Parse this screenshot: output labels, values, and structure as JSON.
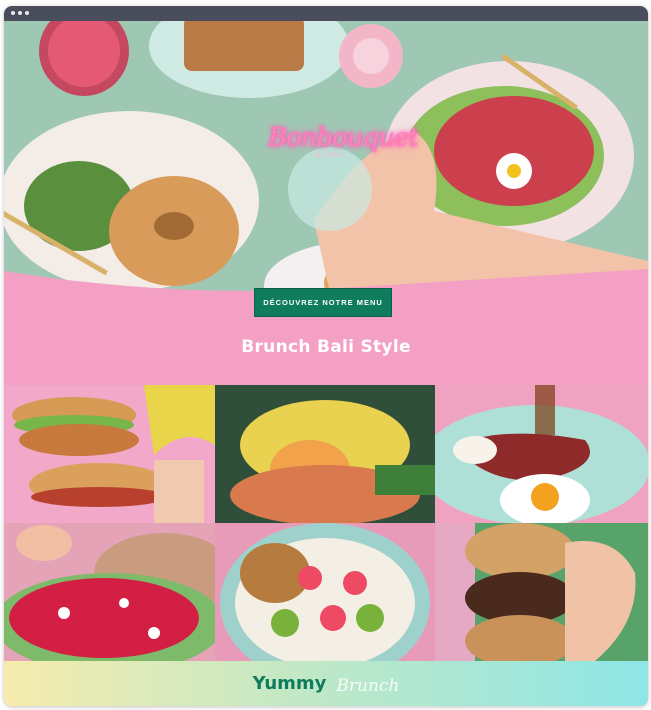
{
  "window": {
    "controls": [
      "dot",
      "dot",
      "dot"
    ]
  },
  "hero": {
    "logo_script": "Bonbouquet",
    "logo_sub": "& CALI",
    "cta_label": "DÉCOUVREZ NOTRE MENU",
    "headline": "Brunch Bali Style"
  },
  "gallery": {
    "tiles": [
      {
        "name": "bagel-sandwich-photo"
      },
      {
        "name": "eggs-benedict-photo"
      },
      {
        "name": "bacon-egg-plate-photo"
      },
      {
        "name": "avocado-toast-pomegranate-photo"
      },
      {
        "name": "granola-bowl-photo"
      },
      {
        "name": "cookie-stack-photo"
      }
    ]
  },
  "footer": {
    "title": "Yummy",
    "script": "Brunch"
  },
  "colors": {
    "accent_green": "#0f7d5d",
    "pink_band": "#f4a0c4",
    "footer_gradient": [
      "#f7ecad",
      "#bde8c8",
      "#8ee6e6"
    ]
  }
}
